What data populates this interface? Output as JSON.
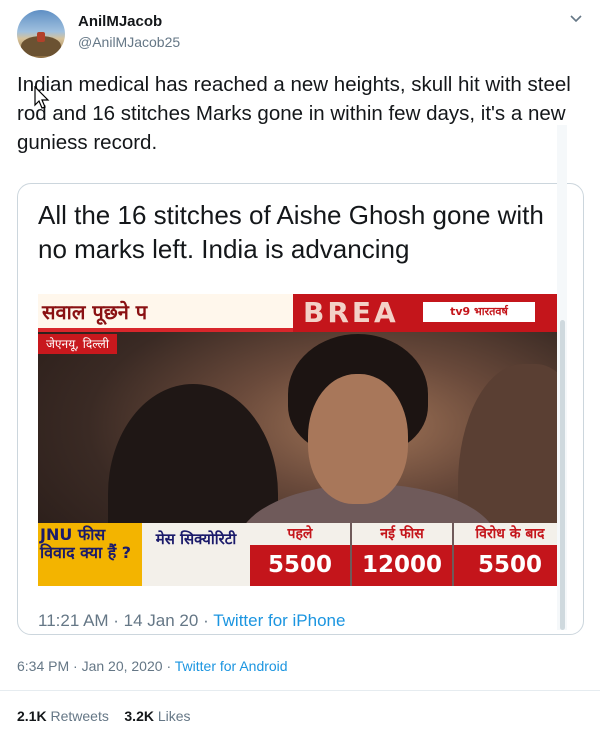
{
  "author": {
    "name": "AnilMJacob",
    "handle": "@AnilMJacob25"
  },
  "tweet": {
    "text": "Indian medical has reached a new heights, skull hit with steel rod and 16 stitches Marks gone in within few days, it's a new guniess record.",
    "timestamp": "6:34 PM · Jan 20, 2020",
    "separator": "·",
    "source": "Twitter for Android",
    "retweets": "2.1K",
    "retweets_label": "Retweets",
    "likes": "3.2K",
    "likes_label": "Likes"
  },
  "quoted": {
    "text": "All the 16 stitches of Aishe Ghosh gone with no marks left. India is advancing",
    "timestamp": "11:21 AM · 14 Jan 20",
    "separator": "·",
    "source": "Twitter for iPhone",
    "video": {
      "headline": "सवाल पूछने प",
      "location": "जेएनयू, दिल्ली",
      "breaking": "BREA",
      "channel": "tv9 भारतवर्ष",
      "jnu_label": "JNU फीस विवाद क्या हैं ?",
      "mess_label": "मेस सिक्योरिटी",
      "columns": [
        {
          "header": "पहले",
          "value": "5500"
        },
        {
          "header": "नई फीस",
          "value": "12000"
        },
        {
          "header": "विरोध के बाद",
          "value": "5500"
        }
      ]
    }
  },
  "colors": {
    "link": "#1b95e0",
    "muted": "#657786",
    "banner_red": "#c4151b",
    "banner_yellow": "#f3b400"
  },
  "icons": [
    "chevron-down-icon",
    "cursor-icon"
  ]
}
